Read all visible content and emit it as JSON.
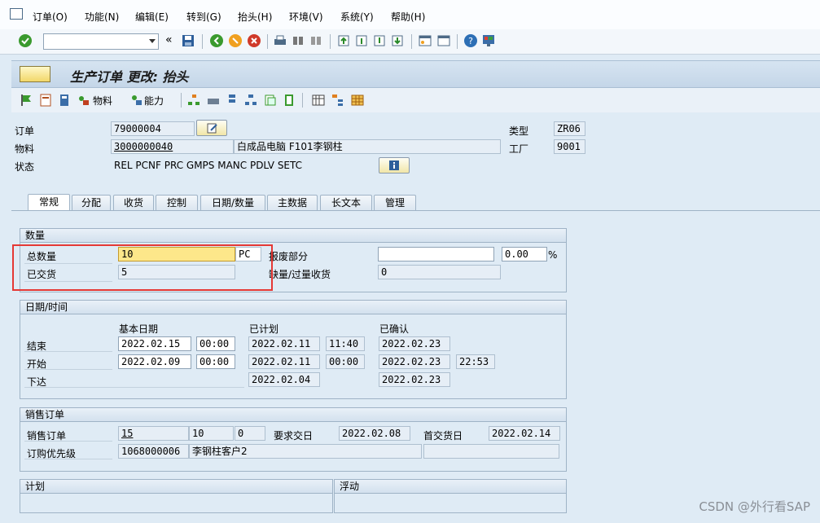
{
  "menu": [
    {
      "name": "menu-order",
      "label": "订单(O)"
    },
    {
      "name": "menu-function",
      "label": "功能(N)"
    },
    {
      "name": "menu-edit",
      "label": "编辑(E)"
    },
    {
      "name": "menu-goto",
      "label": "转到(G)"
    },
    {
      "name": "menu-header",
      "label": "抬头(H)"
    },
    {
      "name": "menu-environment",
      "label": "环境(V)"
    },
    {
      "name": "menu-system",
      "label": "系统(Y)"
    },
    {
      "name": "menu-help",
      "label": "帮助(H)"
    }
  ],
  "toolbar": {
    "command_value": "",
    "back_label": "«"
  },
  "title": "生产订单 更改: 抬头",
  "app_toolbar": {
    "material_label": "物料",
    "capacity_label": "能力"
  },
  "header": {
    "order_label": "订单",
    "order_value": "79000004",
    "material_label": "物料",
    "material_value": "3000000040",
    "material_desc": "白成品电脑 F101李钢柱",
    "status_label": "状态",
    "status_value": "REL  PCNF PRC  GMPS MANC PDLV SETC",
    "type_label": "类型",
    "type_value": "ZR06",
    "plant_label": "工厂",
    "plant_value": "9001"
  },
  "tabs": [
    "常规",
    "分配",
    "收货",
    "控制",
    "日期/数量",
    "主数据",
    "长文本",
    "管理"
  ],
  "quantity": {
    "group_title": "数量",
    "total_label": "总数量",
    "total_value": "10",
    "unit": "PC",
    "delivered_label": "已交货",
    "delivered_value": "5",
    "scrap_label": "报废部分",
    "scrap_value": "",
    "scrap_pct": "0.00",
    "pct_sign": "%",
    "under_over_label": "缺量/过量收货",
    "under_over_value": "0"
  },
  "dates": {
    "group_title": "日期/时间",
    "col_basic": "基本日期",
    "col_scheduled": "已计划",
    "col_confirmed": "已确认",
    "end_label": "结束",
    "start_label": "开始",
    "release_label": "下达",
    "end_basic": "2022.02.15",
    "end_basic_time": "00:00",
    "end_sched": "2022.02.11",
    "end_sched_time": "11:40",
    "end_conf": "2022.02.23",
    "start_basic": "2022.02.09",
    "start_basic_time": "00:00",
    "start_sched": "2022.02.11",
    "start_sched_time": "00:00",
    "start_conf": "2022.02.23",
    "start_conf_time": "22:53",
    "release_sched": "2022.02.04",
    "release_conf": "2022.02.23"
  },
  "sales": {
    "group_title": "销售订单",
    "so_label": "销售订单",
    "so_value": "15",
    "so_item": "10",
    "so_sched": "0",
    "req_date_label": "要求交日",
    "req_date": "2022.02.08",
    "first_date_label": "首交货日",
    "first_date": "2022.02.14",
    "priority_label": "订购优先级",
    "priority_value": "1068000006",
    "customer": "李钢柱客户2"
  },
  "bottom": {
    "plan_label": "计划",
    "float_label": "浮动"
  },
  "watermark": "CSDN @外行看SAP"
}
